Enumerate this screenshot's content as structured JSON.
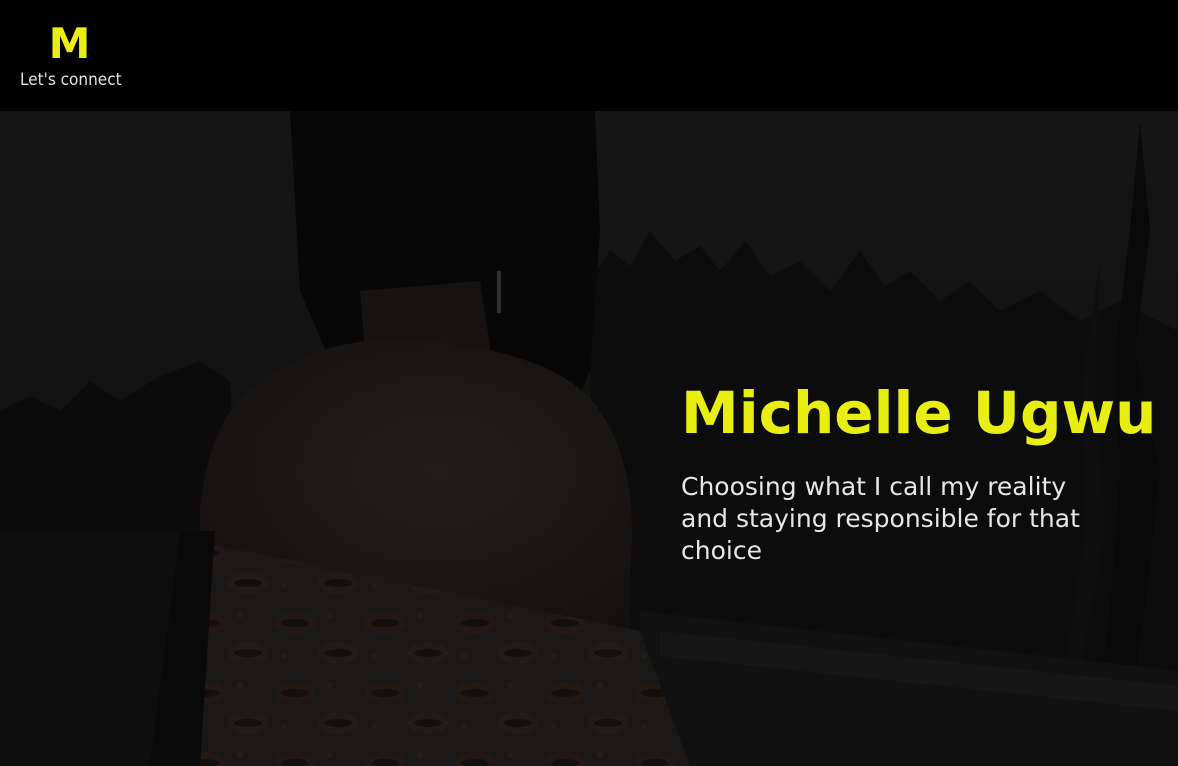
{
  "header": {
    "logo": "M",
    "tagline": "Let's connect"
  },
  "hero": {
    "title": "Michelle Ugwu",
    "subtitle": "Choosing what I call my reality and staying responsible for that choice"
  },
  "colors": {
    "accent": "#e8ef10",
    "background": "#000000",
    "text": "#e6e6e6"
  }
}
